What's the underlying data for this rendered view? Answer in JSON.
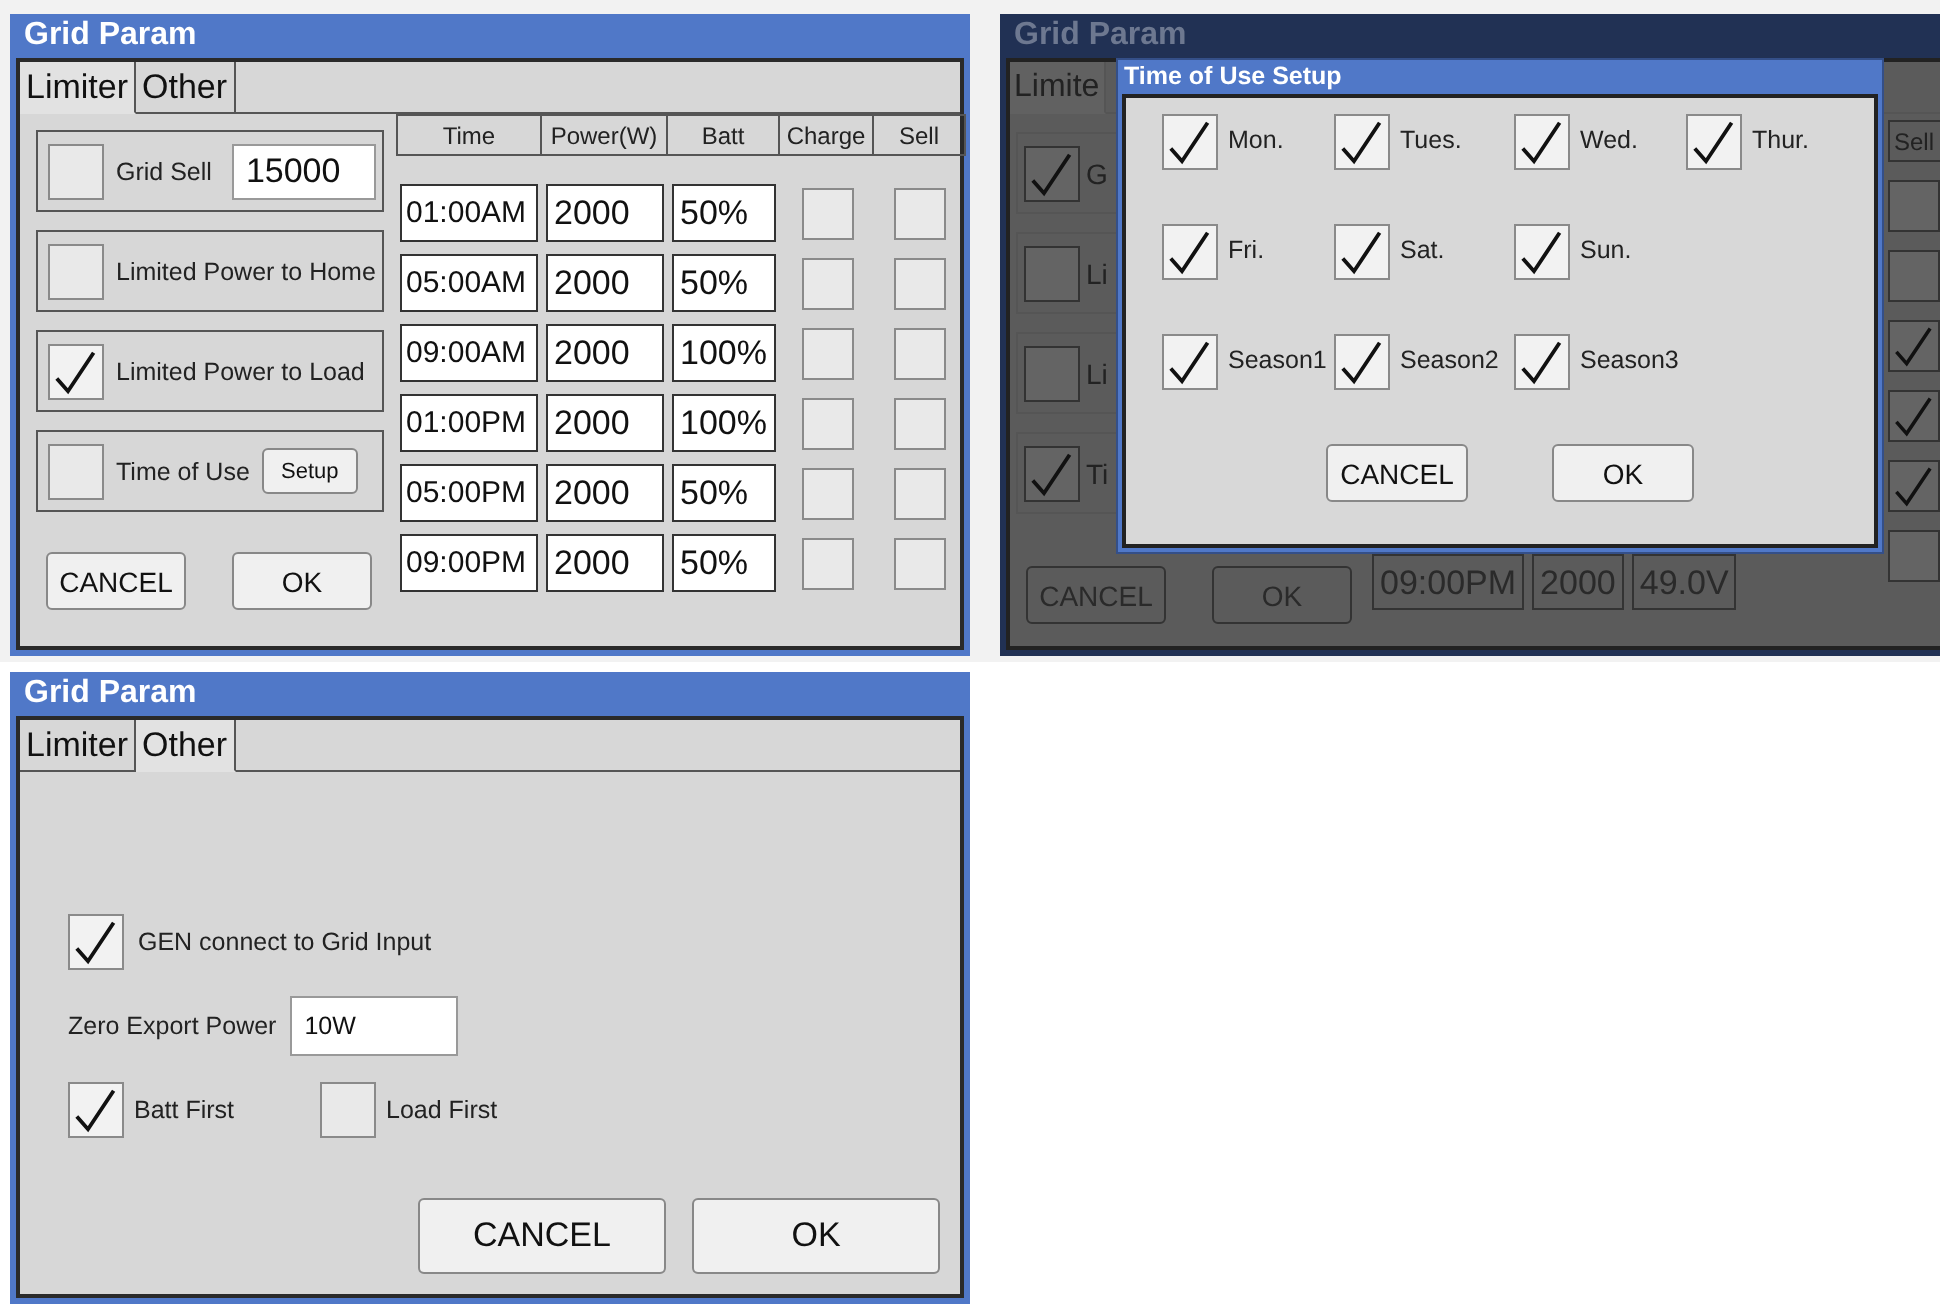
{
  "limiter_window": {
    "title": "Grid Param",
    "tabs": [
      {
        "label": "Limiter",
        "selected": true
      },
      {
        "label": "Other",
        "selected": false
      }
    ],
    "options": [
      {
        "kind": "input",
        "label": "Grid Sell",
        "checked": false,
        "value": "15000"
      },
      {
        "kind": "plain",
        "label": "Limited Power to Home",
        "checked": false
      },
      {
        "kind": "plain",
        "label": "Limited Power to Load",
        "checked": true
      },
      {
        "kind": "button",
        "label": "Time of Use",
        "checked": false,
        "button": "Setup"
      }
    ],
    "table": {
      "columns": [
        "Time",
        "Power(W)",
        "Batt",
        "Charge",
        "Sell"
      ],
      "rows": [
        {
          "time": "01:00AM",
          "power": "2000",
          "batt": "50%",
          "charge": false,
          "sell": false
        },
        {
          "time": "05:00AM",
          "power": "2000",
          "batt": "50%",
          "charge": false,
          "sell": false
        },
        {
          "time": "09:00AM",
          "power": "2000",
          "batt": "100%",
          "charge": false,
          "sell": false
        },
        {
          "time": "01:00PM",
          "power": "2000",
          "batt": "100%",
          "charge": false,
          "sell": false
        },
        {
          "time": "05:00PM",
          "power": "2000",
          "batt": "50%",
          "charge": false,
          "sell": false
        },
        {
          "time": "09:00PM",
          "power": "2000",
          "batt": "50%",
          "charge": false,
          "sell": false
        }
      ]
    },
    "buttons": [
      "CANCEL",
      "OK"
    ]
  },
  "setup_screen": {
    "background": {
      "title": "Grid Param",
      "tabs": [
        {
          "label": "Limite",
          "selected": true
        }
      ],
      "options": [
        {
          "label": "G",
          "checked": true
        },
        {
          "label": "Li",
          "checked": false
        },
        {
          "label": "Li",
          "checked": false
        },
        {
          "label": "Ti",
          "checked": true
        }
      ],
      "sell_column": {
        "heading": "Sell",
        "cells": [
          {
            "checked": false
          },
          {
            "checked": false
          },
          {
            "checked": true
          },
          {
            "checked": true
          },
          {
            "checked": true
          },
          {
            "checked": false
          }
        ]
      },
      "last_row": [
        "09:00PM",
        "2000",
        "49.0V"
      ],
      "buttons": [
        "CANCEL",
        "OK"
      ]
    },
    "dialog": {
      "title": "Time of Use Setup",
      "rows": [
        [
          {
            "label": "Mon.",
            "checked": true
          },
          {
            "label": "Tues.",
            "checked": true
          },
          {
            "label": "Wed.",
            "checked": true
          },
          {
            "label": "Thur.",
            "checked": true
          }
        ],
        [
          {
            "label": "Fri.",
            "checked": true
          },
          {
            "label": "Sat.",
            "checked": true
          },
          {
            "label": "Sun.",
            "checked": true
          }
        ],
        [
          {
            "label": "Season1",
            "checked": true
          },
          {
            "label": "Season2",
            "checked": true
          },
          {
            "label": "Season3",
            "checked": true
          }
        ]
      ],
      "buttons": [
        "CANCEL",
        "OK"
      ]
    }
  },
  "other_window": {
    "title": "Grid Param",
    "tabs": [
      {
        "label": "Limiter",
        "selected": false
      },
      {
        "label": "Other",
        "selected": true
      }
    ],
    "gen_option": {
      "label": "GEN connect to Grid Input",
      "checked": true
    },
    "zero_export": {
      "label": "Zero Export Power",
      "value": "10W"
    },
    "priority": [
      {
        "label": "Batt First",
        "checked": true
      },
      {
        "label": "Load First",
        "checked": false
      }
    ],
    "buttons": [
      "CANCEL",
      "OK"
    ]
  }
}
